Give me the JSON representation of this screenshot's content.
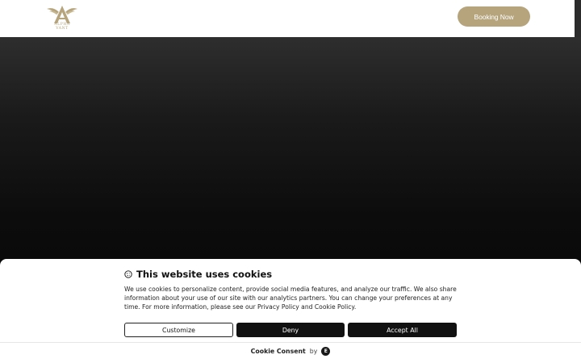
{
  "header": {
    "logo_text": "ALPHA VANT",
    "booking_label": "Booking Now"
  },
  "cookie": {
    "title": "This website uses cookies",
    "body": "We use cookies to personalize content, provide social media features, and analyze our traffic. We also share information about your use of our site with our analytics partners. You can change your preferences at any time. For more information, please see our Privacy Policy and Cookie Policy.",
    "customize_label": "Customize",
    "deny_label": "Deny",
    "accept_label": "Accept All",
    "powered_brand": "Cookie Consent",
    "powered_by": "by",
    "powered_logo_glyph": "E"
  },
  "colors": {
    "accent": "#b5a47c",
    "dark": "#111111"
  },
  "icons": [
    "cookie-icon",
    "logo-icon",
    "elementor-icon"
  ]
}
